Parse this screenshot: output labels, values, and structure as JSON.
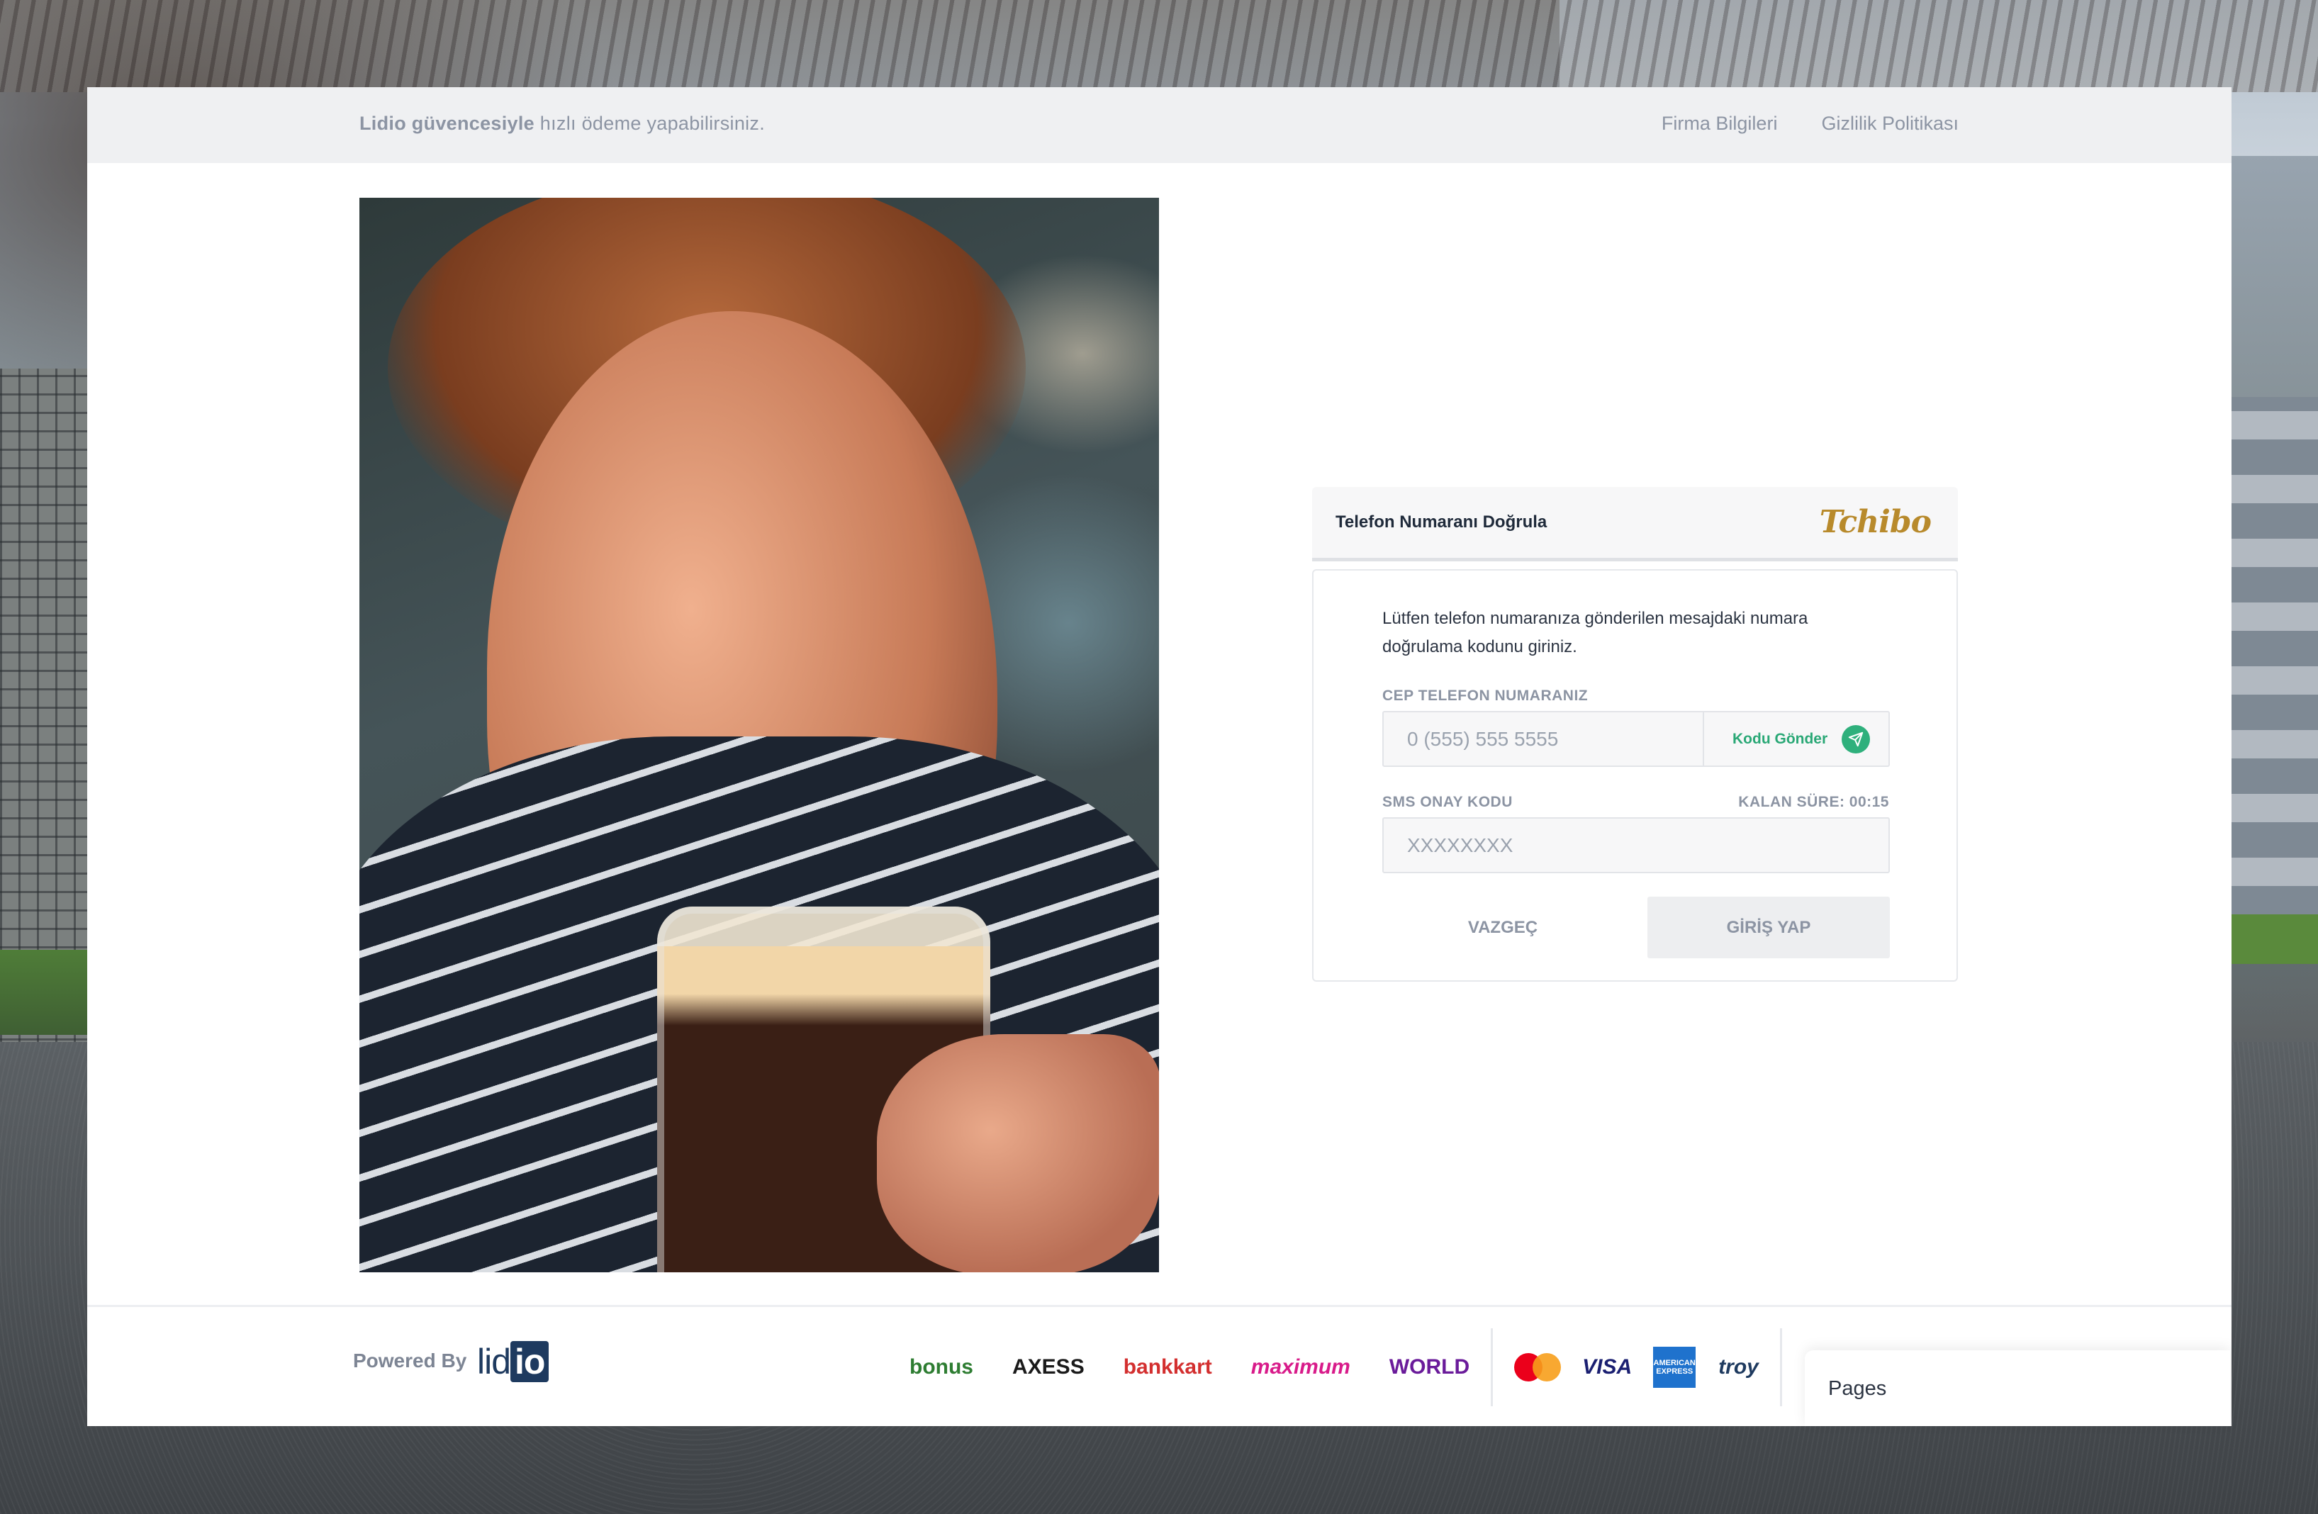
{
  "topbar": {
    "brand_strong": "Lidio güvencesiyle",
    "brand_rest": "hızlı ödeme yapabilirsiniz.",
    "nav": [
      "Firma Bilgileri",
      "Gizlilik Politikası"
    ]
  },
  "verify": {
    "title": "Telefon Numaranı Doğrula",
    "merchant_logo": "Tchibo",
    "description": "Lütfen telefon numaranıza gönderilen mesajdaki numara doğrulama kodunu giriniz.",
    "phone_label": "CEP TELEFON NUMARANIZ",
    "phone_placeholder": "0 (555) 555 5555",
    "send_code": "Kodu Gönder",
    "sms_label": "SMS ONAY KODU",
    "remaining_label": "KALAN SÜRE: 00:15",
    "sms_placeholder": "XXXXXXXX",
    "cancel": "VAZGEÇ",
    "login": "GİRİŞ YAP"
  },
  "footer": {
    "powered_by": "Powered By",
    "logo_left": "lid",
    "logo_right": "io",
    "card_programs": [
      {
        "name": "bonus",
        "color": "#2e7d32"
      },
      {
        "name": "AXESS",
        "color": "#1a1a1a"
      },
      {
        "name": "bankkart",
        "color": "#d32f2f"
      },
      {
        "name": "maximum",
        "color": "#d81b8a"
      },
      {
        "name": "WORLD",
        "color": "#6a1b9a"
      }
    ],
    "networks": {
      "visa": "VISA",
      "amex": "AMERICAN EXPRESS",
      "troy": "troy"
    }
  },
  "popup": {
    "label": "Pages"
  },
  "colors": {
    "accent_green": "#2fb07c",
    "muted_text": "#8c94a3",
    "brand_gold": "#b88a2c"
  }
}
